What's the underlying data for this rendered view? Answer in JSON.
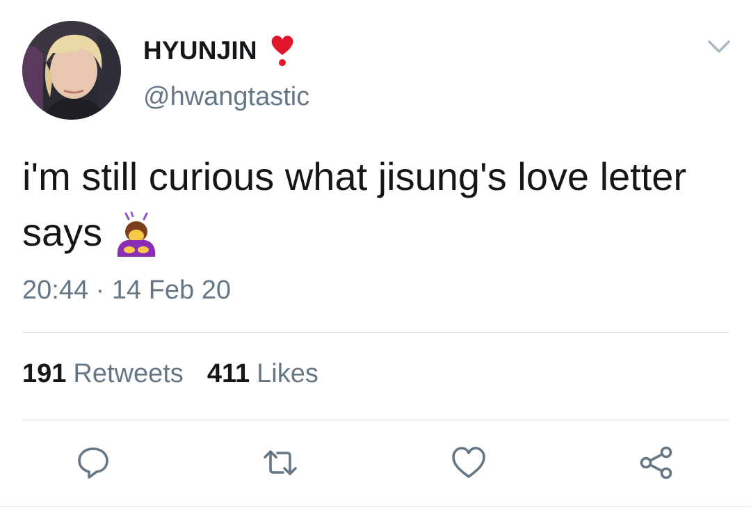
{
  "author": {
    "display_name": "HYUNJIN",
    "handle": "@hwangtastic",
    "name_emoji_icon": "heavy-heart-exclamation-icon",
    "avatar": "profile-photo"
  },
  "tweet": {
    "text": "i'm still curious what jisung's love letter says",
    "trailing_emoji_icon": "person-bowing-icon",
    "time": "20:44",
    "separator": "·",
    "date": "14 Feb 20"
  },
  "stats": {
    "retweets_count": "191",
    "retweets_label": "Retweets",
    "likes_count": "411",
    "likes_label": "Likes"
  },
  "actions": [
    {
      "name": "reply",
      "icon": "reply-bubble-icon"
    },
    {
      "name": "retweet",
      "icon": "retweet-arrows-icon"
    },
    {
      "name": "like",
      "icon": "heart-outline-icon"
    },
    {
      "name": "share",
      "icon": "share-nodes-icon"
    }
  ],
  "colors": {
    "text_primary": "#14171a",
    "text_secondary": "#657786",
    "icon_gray": "#657786",
    "divider": "#d6dce1",
    "heart_red": "#e0162b"
  }
}
